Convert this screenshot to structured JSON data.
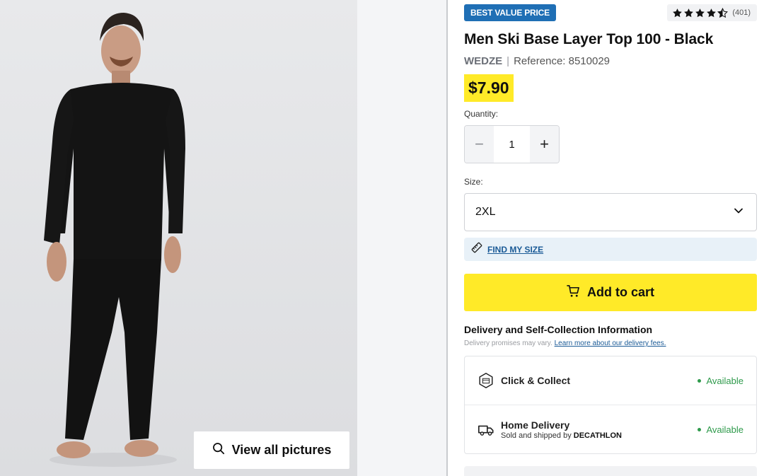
{
  "gallery": {
    "view_all_label": "View all pictures",
    "view_all_icon": "search-icon"
  },
  "product": {
    "badge": "BEST VALUE PRICE",
    "badge_color": "#1f6fb5",
    "rating_stars": 4.5,
    "rating_count": "(401)",
    "title": "Men Ski Base Layer Top 100 - Black",
    "brand": "WEDZE",
    "separator": "|",
    "reference": "Reference: 8510029",
    "price": "$7.90",
    "price_highlight": "#ffea28"
  },
  "quantity": {
    "label": "Quantity:",
    "minus": "−",
    "value": "1",
    "plus": "+"
  },
  "size": {
    "label": "Size:",
    "selected": "2XL"
  },
  "find_size": {
    "label": "FIND MY SIZE",
    "icon": "ruler-icon"
  },
  "cart": {
    "label": "Add to cart",
    "icon": "cart-icon",
    "color": "#ffea28"
  },
  "delivery": {
    "title": "Delivery and Self-Collection Information",
    "note": "Delivery promises may vary.",
    "link": "Learn more about our delivery fees.",
    "options": [
      {
        "name": "Click & Collect",
        "icon": "store-icon",
        "status": "Available"
      },
      {
        "name": "Home Delivery",
        "sub_prefix": "Sold and shipped by",
        "sub_seller": "DECATHLON",
        "icon": "truck-icon",
        "status": "Available"
      }
    ],
    "status_color": "#2e9a4b"
  }
}
